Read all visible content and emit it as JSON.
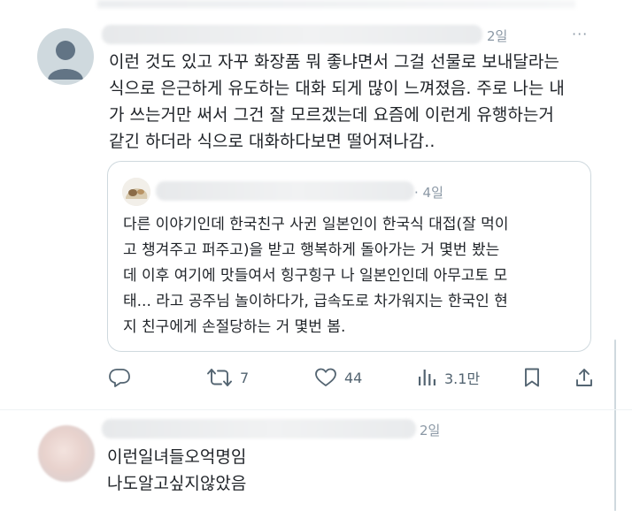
{
  "post1": {
    "time": "2일",
    "more": "···",
    "lines": [
      "이런 것도 있고 자꾸 화장품 뭐 좋냐면서 그걸 선물로 보내달라는",
      "식으로 은근하게 유도하는 대화 되게 많이 느껴졌음. 주로 나는 내",
      "가 쓰는거만 써서 그건 잘 모르겠는데 요즘에 이런게 유행하는거",
      "같긴 하더라 식으로 대화하다보면 떨어져나감.."
    ],
    "quote": {
      "time": "· 4일",
      "lines": [
        "다른 이야기인데 한국친구 사귄 일본인이 한국식 대접(잘 먹이",
        "고 챙겨주고 퍼주고)을 받고 행복하게 돌아가는 거 몇번 봤는",
        "데 이후 여기에 맛들여서 힝구힝구 나 일본인인데 아무고토 모",
        "태... 라고 공주님 놀이하다가, 급속도로 차가워지는 한국인 현",
        "지 친구에게 손절당하는 거 몇번 봄."
      ]
    },
    "actions": {
      "retweets": "7",
      "likes": "44",
      "views": "3.1만"
    }
  },
  "post2": {
    "time": "2일",
    "lines": [
      "이런일녀들오억명임",
      "나도알고싶지않았음"
    ]
  },
  "icons": {
    "reply": "reply-icon",
    "retweet": "retweet-icon",
    "like": "heart-icon",
    "views": "views-icon",
    "bookmark": "bookmark-icon",
    "share": "share-icon",
    "more": "more-icon"
  },
  "colors": {
    "text": "#0f1419",
    "muted": "#536471",
    "border": "#cfd9de"
  }
}
